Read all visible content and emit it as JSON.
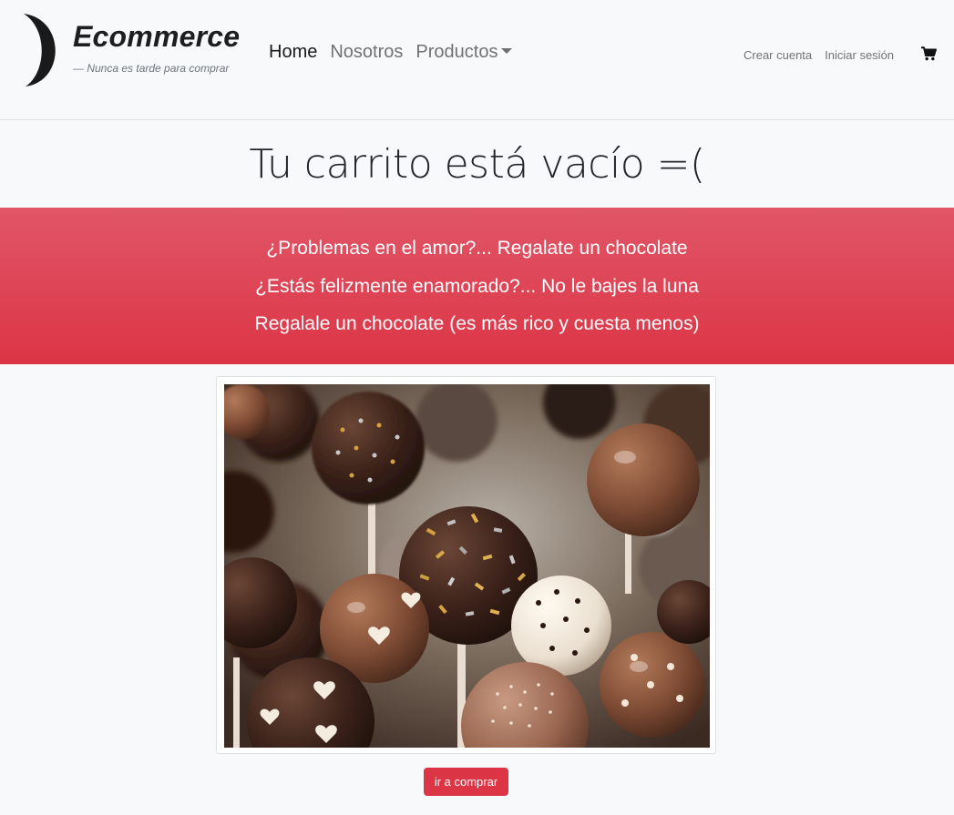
{
  "brand": {
    "title": "Ecommerce",
    "tagline": "— Nunca es tarde para comprar",
    "logo_icon": "crescent-moon-icon"
  },
  "nav": {
    "items": [
      {
        "label": "Home",
        "active": true
      },
      {
        "label": "Nosotros",
        "active": false
      },
      {
        "label": "Productos",
        "active": false,
        "dropdown": true
      }
    ]
  },
  "account": {
    "create_label": "Crear cuenta",
    "login_label": "Iniciar sesión",
    "cart_icon": "shopping-cart-icon"
  },
  "main": {
    "title": "Tu carrito está vacío =(",
    "banner_lines": [
      "¿Problemas en el amor?... Regalate un chocolate",
      "¿Estás felizmente enamorado?... No le bajes la luna",
      "Regalale un chocolate (es más rico y cuesta menos)"
    ],
    "image_subject": "chocolate-cake-pops-photo",
    "button_label": "ir a comprar"
  },
  "colors": {
    "accent": "#dc3545",
    "background": "#f8f9fa"
  }
}
